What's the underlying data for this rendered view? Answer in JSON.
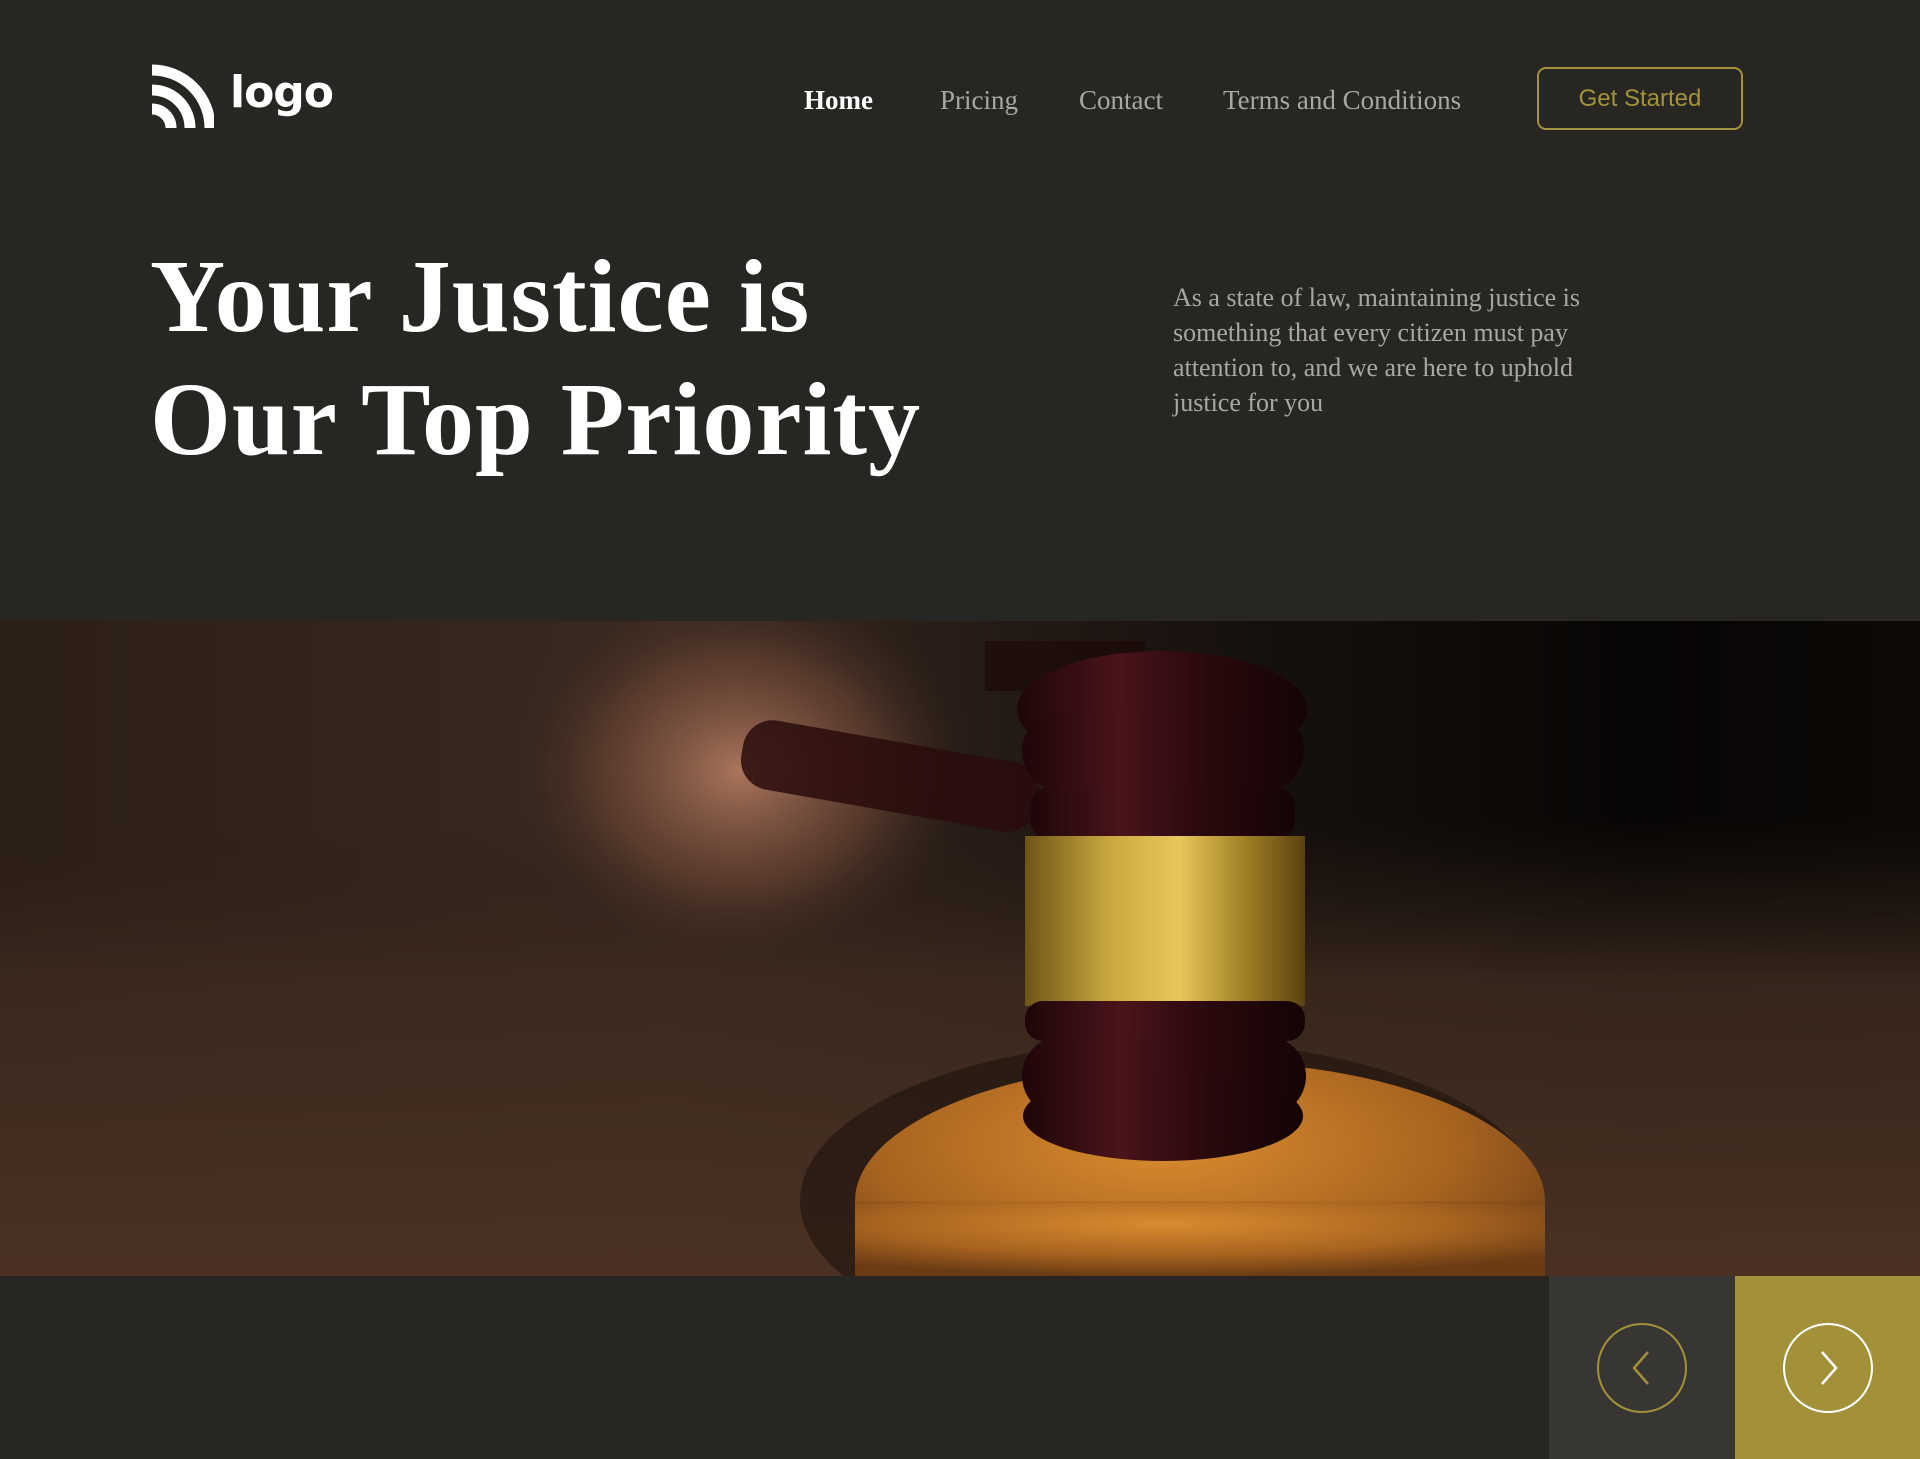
{
  "brand": {
    "logo_text": "logo",
    "logo_icon": "wifi-arcs-icon"
  },
  "nav": {
    "items": [
      {
        "label": "Home",
        "active": true
      },
      {
        "label": "Pricing",
        "active": false
      },
      {
        "label": "Contact",
        "active": false
      },
      {
        "label": "Terms and Conditions",
        "active": false
      }
    ],
    "cta_label": "Get Started"
  },
  "hero": {
    "title_line1": "Your Justice is",
    "title_line2": "Our Top Priority",
    "description": "As a state of law, maintaining justice is something that every citizen must pay attention to, and we are here to uphold justice for you"
  },
  "carousel": {
    "prev_icon": "chevron-left-icon",
    "next_icon": "chevron-right-icon"
  },
  "colors": {
    "background": "#272622",
    "accent": "#a39139",
    "text_primary": "#ffffff",
    "text_muted": "#a9a7a2",
    "control_dark": "#383632"
  }
}
